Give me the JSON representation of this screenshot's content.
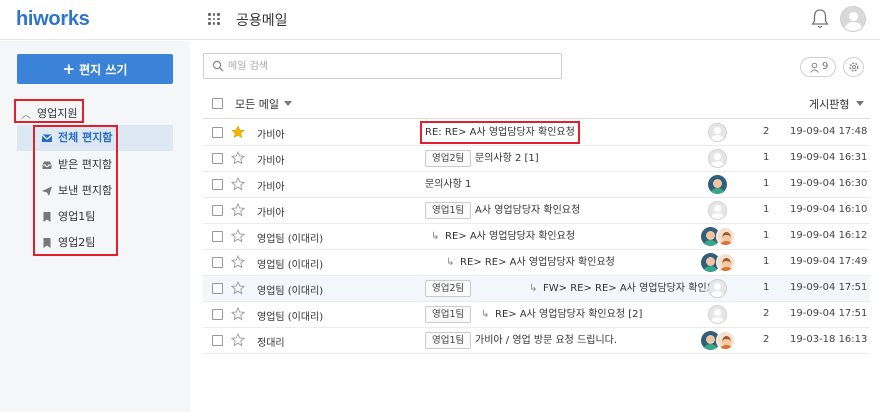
{
  "header": {
    "logo": "hiworks",
    "app_title": "공용메일"
  },
  "sidebar": {
    "compose_label": "편지 쓰기",
    "group_label": "영업지원",
    "folders": [
      {
        "label": "전체 편지함",
        "icon": "envelope-icon",
        "active": true
      },
      {
        "label": "받은 편지함",
        "icon": "inbox-tray-icon",
        "active": false
      },
      {
        "label": "보낸 편지함",
        "icon": "paper-plane-icon",
        "active": false
      },
      {
        "label": "영업1팀",
        "icon": "bookmark-icon",
        "active": false
      },
      {
        "label": "영업2팀",
        "icon": "bookmark-icon",
        "active": false
      }
    ]
  },
  "search": {
    "placeholder": "메일 검색"
  },
  "toolbar": {
    "people_count": "9"
  },
  "list": {
    "filter_label": "모든 메일",
    "view_label": "게시판형",
    "rows": [
      {
        "starred": true,
        "sender": "가비아",
        "tag": "",
        "indent": 0,
        "subject": "RE: RE> A사 영업담당자 확인요청",
        "avatars": [
          "empty"
        ],
        "count": "2",
        "date": "19-09-04 17:48"
      },
      {
        "starred": false,
        "sender": "가비아",
        "tag": "영업2팀",
        "indent": 0,
        "subject": "문의사항 2 [1]",
        "avatars": [
          "empty"
        ],
        "count": "1",
        "date": "19-09-04 16:31"
      },
      {
        "starred": false,
        "sender": "가비아",
        "tag": "",
        "indent": 0,
        "subject": "문의사항 1",
        "avatars": [
          "a"
        ],
        "count": "1",
        "date": "19-09-04 16:30"
      },
      {
        "starred": false,
        "sender": "가비아",
        "tag": "영업1팀",
        "indent": 0,
        "subject": "A사 영업담당자 확인요청",
        "avatars": [
          "empty"
        ],
        "count": "1",
        "date": "19-09-04 16:10"
      },
      {
        "starred": false,
        "sender": "영업팀 (이대리)",
        "tag": "",
        "indent": 1,
        "subject": "RE> A사 영업담당자 확인요청",
        "avatars": [
          "a",
          "b"
        ],
        "count": "1",
        "date": "19-09-04 16:12"
      },
      {
        "starred": false,
        "sender": "영업팀 (이대리)",
        "tag": "",
        "indent": 2,
        "subject": "RE> RE> A사 영업담당자 확인요청",
        "avatars": [
          "a",
          "b"
        ],
        "count": "1",
        "date": "19-09-04 17:49"
      },
      {
        "starred": false,
        "sender": "영업팀 (이대리)",
        "tag": "영업2팀",
        "indent": 3,
        "subject": "FW> RE> RE> A사 영업담당자 확인요청",
        "avatars": [
          "empty"
        ],
        "count": "1",
        "date": "19-09-04 17:51"
      },
      {
        "starred": false,
        "sender": "영업팀 (이대리)",
        "tag": "영업1팀",
        "indent": 1,
        "subject": "RE> A사 영업담당자 확인요청 [2]",
        "avatars": [
          "empty"
        ],
        "count": "2",
        "date": "19-09-04 17:51"
      },
      {
        "starred": false,
        "sender": "정대리",
        "tag": "영업1팀",
        "indent": 0,
        "subject": "가비아 / 영업 방문 요청 드립니다.",
        "avatars": [
          "a",
          "b"
        ],
        "count": "2",
        "date": "19-03-18 16:13"
      }
    ]
  }
}
